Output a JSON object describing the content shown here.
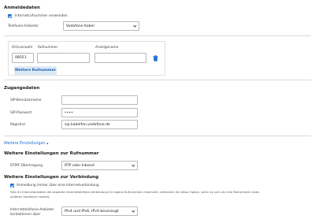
{
  "anmeldedaten": {
    "title": "Anmeldedaten",
    "checkbox_label": "Internetrufnummer verwenden",
    "provider_label": "Telefonie-Anbieter",
    "provider_value": "Vodafone Kabel"
  },
  "rufnummer_table": {
    "col_ortsvorwahl": "Ortsvorwahl",
    "col_rufnummer": "Rufnummer",
    "col_anzeigename": "Anzeigename",
    "row_ortsvorwahl_value": "08551",
    "row_rufnummer_value": "",
    "row_anzeigename_value": "",
    "add_button": "Weitere Rufnummer"
  },
  "zugangsdaten": {
    "title": "Zugangsdaten",
    "sip_user_label": "SIP-Benutzername",
    "sip_user_value": "",
    "sip_pass_label": "SIP-Passwort",
    "sip_pass_value": "••••",
    "registrar_label": "Registrar",
    "registrar_value": "sip.kabelfon.vodafone.de"
  },
  "weitere": {
    "toggle_link": "Weitere Einstellungen ▴",
    "rufnummer_title": "Weitere Einstellungen zur Rufnummer",
    "dtmf_label": "DTMF-Übertragung",
    "dtmf_value": "RTP oder Inband",
    "verbindung_title": "Weitere Einstellungen zur Verbindung",
    "anmeldung_checkbox": "Anmeldung immer über eine Internetverbindung",
    "info_text_line1": "Falls Ihr Internetanbieter die separate Internettelefonie-Verbindung für eigene Rufnummern reserviert, aktivieren Sie diese Option, wenn es sich um eine Rufnummer eines",
    "info_text_line2": "anderen Anbieters handelt.",
    "anbieter_label_line1": "Internettelefonie-Anbieter",
    "anbieter_label_line2": "kontaktieren über",
    "anbieter_value": "IPv4 und IPv6, IPv4 bevorzugt"
  },
  "icons": {
    "check": "check-icon",
    "chevron": "chevron-down-icon",
    "trash": "trash-icon"
  },
  "colors": {
    "accent": "#1f6fd1",
    "button_bg": "#dce9f8",
    "trash": "#1f6fd1"
  }
}
